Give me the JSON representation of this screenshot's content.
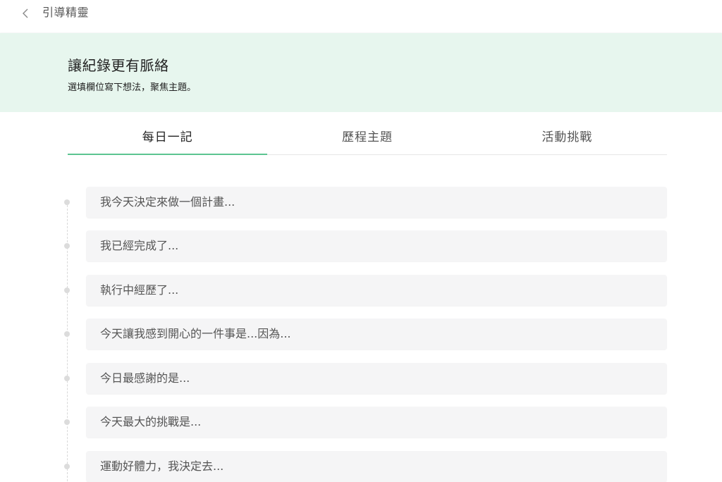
{
  "header": {
    "back_icon": "chevron-left-icon",
    "title": "引導精靈"
  },
  "banner": {
    "title": "讓紀錄更有脈絡",
    "subtitle": "選填欄位寫下想法，聚焦主題。",
    "background_color": "#e7f6ee"
  },
  "tabs": [
    {
      "label": "每日一記",
      "active": true
    },
    {
      "label": "歷程主題",
      "active": false
    },
    {
      "label": "活動挑戰",
      "active": false
    }
  ],
  "accent_color": "#5cc491",
  "prompts": [
    {
      "placeholder": "我今天決定來做一個計畫..."
    },
    {
      "placeholder": "我已經完成了..."
    },
    {
      "placeholder": "執行中經歷了..."
    },
    {
      "placeholder": "今天讓我感到開心的一件事是...因為..."
    },
    {
      "placeholder": "今日最感謝的是..."
    },
    {
      "placeholder": "今天最大的挑戰是..."
    },
    {
      "placeholder": "運動好體力，我決定去..."
    }
  ]
}
